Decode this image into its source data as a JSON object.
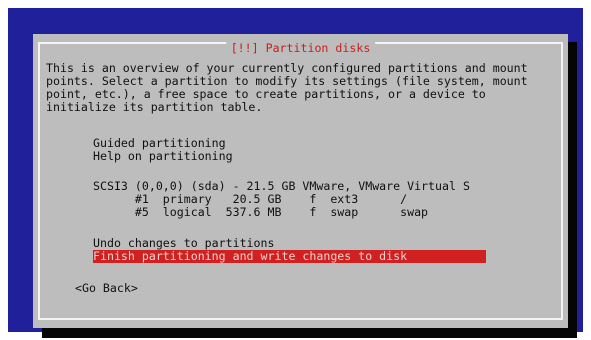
{
  "dialog": {
    "title": "[!!] Partition disks",
    "description": [
      "This is an overview of your currently configured partitions and mount",
      "points. Select a partition to modify its settings (file system, mount",
      "point, etc.), a free space to create partitions, or a device to",
      "initialize its partition table."
    ]
  },
  "menu": {
    "guided": "Guided partitioning",
    "help": "Help on partitioning",
    "disk": "SCSI3 (0,0,0) (sda) - 21.5 GB VMware, VMware Virtual S",
    "partitions": [
      "      #1  primary   20.5 GB    f  ext3      /",
      "      #5  logical  537.6 MB    f  swap      swap"
    ],
    "undo": "Undo changes to partitions",
    "finish": "Finish partitioning and write changes to disk"
  },
  "buttons": {
    "back": "<Go Back>"
  },
  "colors": {
    "screen_background": "#20209a",
    "dialog_background": "#bdbdbd",
    "title_text": "#c81e1e",
    "selected_background": "#d12020"
  }
}
